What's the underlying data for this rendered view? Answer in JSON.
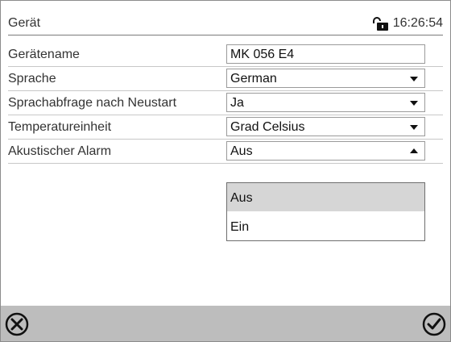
{
  "header": {
    "title": "Gerät",
    "time": "16:26:54"
  },
  "rows": [
    {
      "label": "Gerätename",
      "value": "MK 056 E4",
      "type": "text"
    },
    {
      "label": "Sprache",
      "value": "German",
      "type": "select"
    },
    {
      "label": "Sprachabfrage nach Neustart",
      "value": "Ja",
      "type": "select"
    },
    {
      "label": "Temperatureinheit",
      "value": "Grad Celsius",
      "type": "select"
    },
    {
      "label": "Akustischer Alarm",
      "value": "Aus",
      "type": "select-open"
    }
  ],
  "dropdown": {
    "options": [
      "Aus",
      "Ein"
    ],
    "selected": "Aus"
  },
  "footer": {
    "cancel_icon": "circle-x-icon",
    "confirm_icon": "circle-check-icon"
  },
  "colors": {
    "footer_bg": "#bdbdbd",
    "selected_option_bg": "#d6d6d6"
  }
}
